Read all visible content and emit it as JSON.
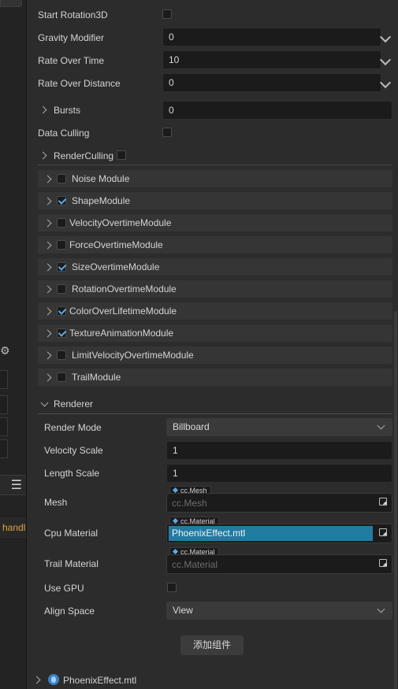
{
  "left_panel": {
    "handle_text": "handl"
  },
  "properties": {
    "start_rotation3d": {
      "label": "Start Rotation3D",
      "checked": false
    },
    "gravity_modifier": {
      "label": "Gravity Modifier",
      "value": "0"
    },
    "rate_over_time": {
      "label": "Rate Over Time",
      "value": "10"
    },
    "rate_over_distance": {
      "label": "Rate Over Distance",
      "value": "0"
    },
    "bursts": {
      "label": "Bursts",
      "value": "0"
    },
    "data_culling": {
      "label": "Data Culling",
      "checked": false
    },
    "render_culling": {
      "label": "RenderCulling",
      "checked": false
    }
  },
  "modules": [
    {
      "label": "Noise Module",
      "checked": false
    },
    {
      "label": "ShapeModule",
      "checked": true
    },
    {
      "label": "VelocityOvertimeModule",
      "checked": false
    },
    {
      "label": "ForceOvertimeModule",
      "checked": false
    },
    {
      "label": "SizeOvertimeModule",
      "checked": true
    },
    {
      "label": "RotationOvertimeModule",
      "checked": false
    },
    {
      "label": "ColorOverLifetimeModule",
      "checked": true
    },
    {
      "label": "TextureAnimationModule",
      "checked": true
    },
    {
      "label": "LimitVelocityOvertimeModule",
      "checked": false
    },
    {
      "label": "TrailModule",
      "checked": false
    }
  ],
  "renderer": {
    "section_label": "Renderer",
    "render_mode": {
      "label": "Render Mode",
      "value": "Billboard"
    },
    "velocity_scale": {
      "label": "Velocity Scale",
      "value": "1"
    },
    "length_scale": {
      "label": "Length Scale",
      "value": "1"
    },
    "mesh": {
      "label": "Mesh",
      "type_tag": "cc.Mesh",
      "placeholder": "cc.Mesh"
    },
    "cpu_material": {
      "label": "Cpu Material",
      "type_tag": "cc.Material",
      "value": "PhoenixEffect.mtl"
    },
    "trail_material": {
      "label": "Trail Material",
      "type_tag": "cc.Material",
      "placeholder": "cc.Material"
    },
    "use_gpu": {
      "label": "Use GPU",
      "checked": false
    },
    "align_space": {
      "label": "Align Space",
      "value": "View"
    }
  },
  "add_component_label": "添加组件",
  "footer": {
    "asset_label": "PhoenixEffect.mtl"
  },
  "colors": {
    "accent": "#5aa9e6",
    "selection": "#227ba1",
    "warning_text": "#e0a33a"
  }
}
